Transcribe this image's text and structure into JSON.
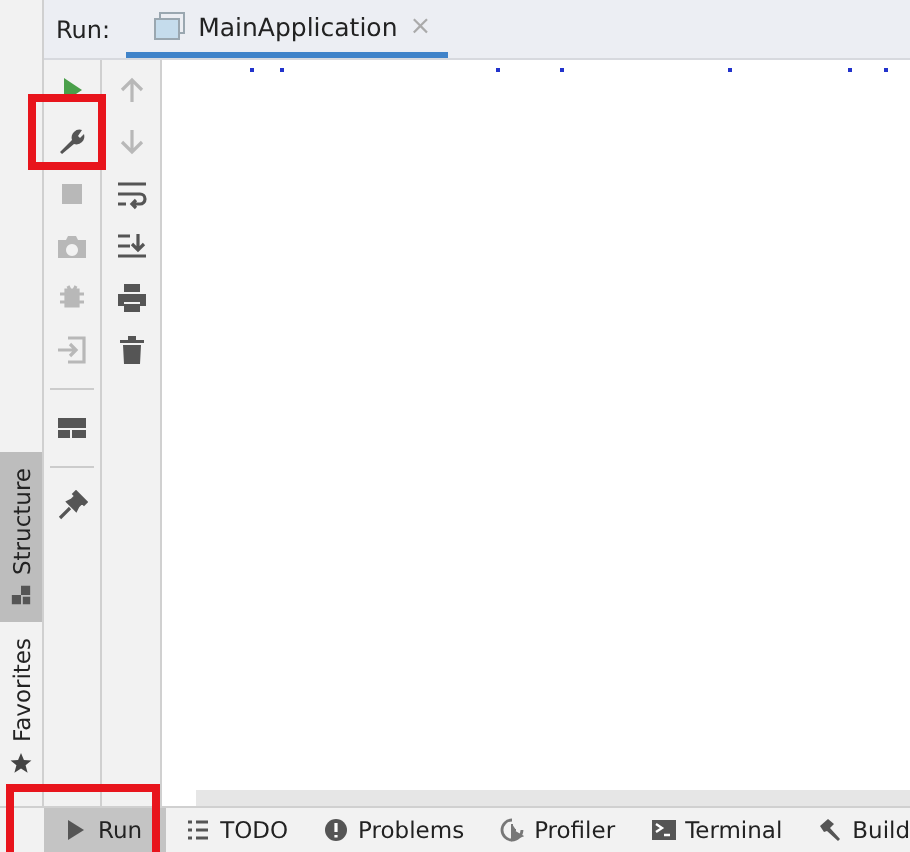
{
  "run_panel": {
    "label": "Run:",
    "tabs": [
      {
        "label": "MainApplication",
        "close": "×",
        "selected": true
      }
    ]
  },
  "toolbar_left": [
    {
      "kind": "run",
      "disabled": false
    },
    {
      "kind": "wrench",
      "disabled": false
    },
    {
      "kind": "stop",
      "disabled": true
    },
    {
      "kind": "camera",
      "disabled": true
    },
    {
      "kind": "bug",
      "disabled": true
    },
    {
      "kind": "exit",
      "disabled": true
    },
    {
      "kind": "separator"
    },
    {
      "kind": "layout",
      "disabled": false
    },
    {
      "kind": "separator"
    },
    {
      "kind": "pin",
      "disabled": false
    }
  ],
  "toolbar_right": [
    {
      "kind": "up",
      "disabled": true
    },
    {
      "kind": "down",
      "disabled": true
    },
    {
      "kind": "wrap",
      "disabled": false
    },
    {
      "kind": "scroll-end",
      "disabled": false
    },
    {
      "kind": "print",
      "disabled": false
    },
    {
      "kind": "trash",
      "disabled": false
    }
  ],
  "side_tabs": [
    {
      "label": "Structure",
      "kind": "structure",
      "selected": true
    },
    {
      "label": "Favorites",
      "kind": "star",
      "selected": false
    }
  ],
  "bottom_tabs": [
    {
      "label": "Run",
      "kind": "run",
      "selected": true
    },
    {
      "label": "TODO",
      "kind": "list",
      "selected": false
    },
    {
      "label": "Problems",
      "kind": "problems",
      "selected": false
    },
    {
      "label": "Profiler",
      "kind": "profiler",
      "selected": false
    },
    {
      "label": "Terminal",
      "kind": "terminal",
      "selected": false
    },
    {
      "label": "Build",
      "kind": "hammer",
      "selected": false
    }
  ]
}
